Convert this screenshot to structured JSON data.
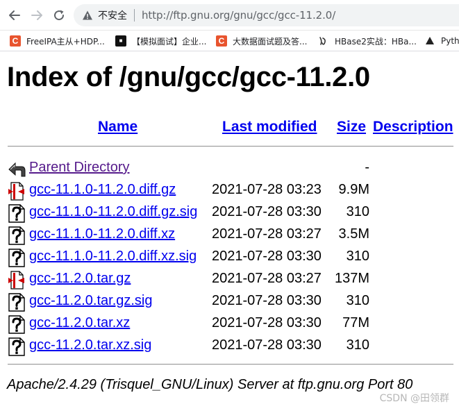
{
  "browser": {
    "security_label": "不安全",
    "url": "http://ftp.gnu.org/gnu/gcc/gcc-11.2.0/"
  },
  "bookmarks": [
    {
      "icon": "csdn-c-icon",
      "label": "FreeIPA主从+HDP..."
    },
    {
      "icon": "site-icon",
      "label": "【模拟面试】企业..."
    },
    {
      "icon": "csdn-c-icon",
      "label": "大数据面试题及答..."
    },
    {
      "icon": "ink-bird-icon",
      "label": "HBase2实战：HBa..."
    },
    {
      "icon": "pyth-icon",
      "label": "Pyth"
    }
  ],
  "page": {
    "title": "Index of /gnu/gcc/gcc-11.2.0",
    "columns": {
      "name": "Name",
      "last_modified": "Last modified",
      "size": "Size",
      "description": "Description"
    },
    "parent": {
      "label": "Parent Directory",
      "size": "-"
    },
    "files": [
      {
        "name": "gcc-11.1.0-11.2.0.diff.gz",
        "date": "2021-07-28 03:23",
        "size": "9.9M",
        "icon": "compressed-file-icon"
      },
      {
        "name": "gcc-11.1.0-11.2.0.diff.gz.sig",
        "date": "2021-07-28 03:30",
        "size": "310",
        "icon": "unknown-file-icon"
      },
      {
        "name": "gcc-11.1.0-11.2.0.diff.xz",
        "date": "2021-07-28 03:27",
        "size": "3.5M",
        "icon": "unknown-file-icon"
      },
      {
        "name": "gcc-11.1.0-11.2.0.diff.xz.sig",
        "date": "2021-07-28 03:30",
        "size": "310",
        "icon": "unknown-file-icon"
      },
      {
        "name": "gcc-11.2.0.tar.gz",
        "date": "2021-07-28 03:27",
        "size": "137M",
        "icon": "compressed-file-icon"
      },
      {
        "name": "gcc-11.2.0.tar.gz.sig",
        "date": "2021-07-28 03:30",
        "size": "310",
        "icon": "unknown-file-icon"
      },
      {
        "name": "gcc-11.2.0.tar.xz",
        "date": "2021-07-28 03:30",
        "size": "77M",
        "icon": "unknown-file-icon"
      },
      {
        "name": "gcc-11.2.0.tar.xz.sig",
        "date": "2021-07-28 03:30",
        "size": "310",
        "icon": "unknown-file-icon"
      }
    ],
    "footer": "Apache/2.4.29 (Trisquel_GNU/Linux) Server at ftp.gnu.org Port 80"
  },
  "watermark": "CSDN @田领群",
  "colors": {
    "link": "#0000ee",
    "visited_link": "#551a8b"
  }
}
